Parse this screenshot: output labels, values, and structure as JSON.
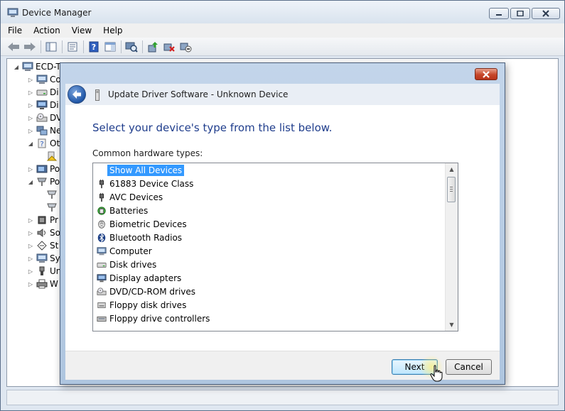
{
  "window": {
    "title": "Device Manager",
    "accent_color": "#1f3d8c"
  },
  "menu": [
    "File",
    "Action",
    "View",
    "Help"
  ],
  "toolbar": [
    "back-icon",
    "forward-icon",
    "show-hide-console-tree-icon",
    "properties-icon",
    "help-icon",
    "action-pane-icon",
    "scan-hardware-icon",
    "update-driver-icon",
    "uninstall-icon",
    "disable-icon"
  ],
  "tree": {
    "root": "ECD-T",
    "items": [
      {
        "label": "Co",
        "icon": "computer-icon"
      },
      {
        "label": "Di",
        "icon": "disk-icon"
      },
      {
        "label": "Di",
        "icon": "display-icon"
      },
      {
        "label": "DV",
        "icon": "dvd-icon"
      },
      {
        "label": "Ne",
        "icon": "network-icon"
      },
      {
        "label": "Ot",
        "icon": "other-devices-icon"
      },
      {
        "label": "",
        "icon": "unknown-device-icon"
      },
      {
        "label": "Po",
        "icon": "portable-icon"
      },
      {
        "label": "Po",
        "icon": "ports-icon"
      },
      {
        "label": "",
        "icon": "port-icon"
      },
      {
        "label": "",
        "icon": "port-icon"
      },
      {
        "label": "Pr",
        "icon": "processor-icon"
      },
      {
        "label": "So",
        "icon": "sound-icon"
      },
      {
        "label": "St",
        "icon": "storage-icon"
      },
      {
        "label": "Sy",
        "icon": "system-icon"
      },
      {
        "label": "Un",
        "icon": "usb-icon"
      },
      {
        "label": "W",
        "icon": "printer-icon"
      }
    ]
  },
  "dialog": {
    "title": "Update Driver Software - Unknown Device",
    "instruction": "Select your device's type from the list below.",
    "list_label": "Common hardware types:",
    "items": [
      {
        "label": "Show All Devices",
        "selected": true,
        "icon": ""
      },
      {
        "label": "61883 Device Class",
        "icon": "plug-icon"
      },
      {
        "label": "AVC Devices",
        "icon": "plug-icon"
      },
      {
        "label": "Batteries",
        "icon": "battery-icon"
      },
      {
        "label": "Biometric Devices",
        "icon": "fingerprint-icon"
      },
      {
        "label": "Bluetooth Radios",
        "icon": "bluetooth-icon"
      },
      {
        "label": "Computer",
        "icon": "computer-icon"
      },
      {
        "label": "Disk drives",
        "icon": "disk-icon"
      },
      {
        "label": "Display adapters",
        "icon": "display-icon"
      },
      {
        "label": "DVD/CD-ROM drives",
        "icon": "dvd-icon"
      },
      {
        "label": "Floppy disk drives",
        "icon": "floppy-icon"
      },
      {
        "label": "Floppy drive controllers",
        "icon": "floppy-controller-icon"
      }
    ],
    "next_label": "Next",
    "cancel_label": "Cancel"
  }
}
